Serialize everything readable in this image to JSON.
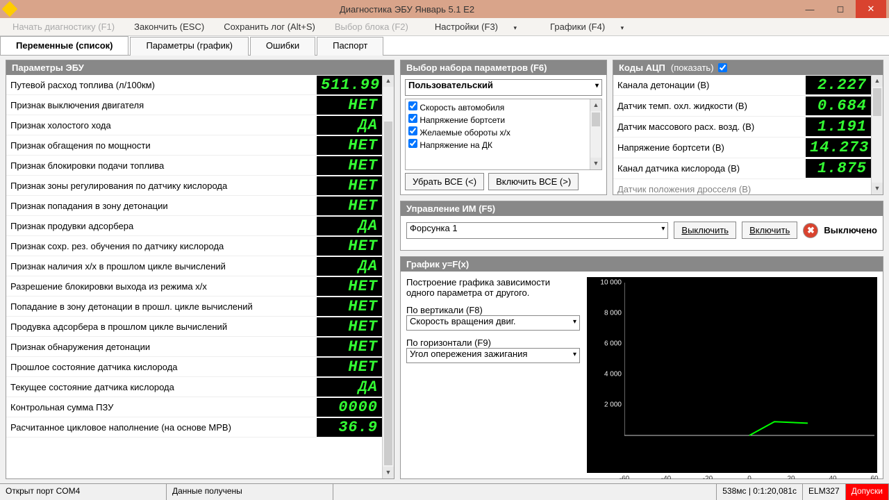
{
  "title": "Диагностика ЭБУ Январь 5.1 Е2",
  "toolbar": {
    "start": "Начать диагностику (F1)",
    "finish": "Закончить (ESC)",
    "savelog": "Сохранить лог (Alt+S)",
    "block": "Выбор блока (F2)",
    "settings": "Настройки (F3)",
    "graphs": "Графики (F4)"
  },
  "tabs": {
    "vars": "Переменные (список)",
    "params": "Параметры (график)",
    "errors": "Ошибки",
    "passport": "Паспорт"
  },
  "ecu_params": {
    "title": "Параметры ЭБУ",
    "rows": [
      {
        "n": "Путевой расход топлива (л/100км)",
        "v": "511.99"
      },
      {
        "n": "Признак выключения двигателя",
        "v": "НЕТ"
      },
      {
        "n": "Признак холостого хода",
        "v": "ДА"
      },
      {
        "n": "Признак обгащения по мощности",
        "v": "НЕТ"
      },
      {
        "n": "Признак блокировки подачи топлива",
        "v": "НЕТ"
      },
      {
        "n": "Признак зоны регулирования по датчику кислорода",
        "v": "НЕТ"
      },
      {
        "n": "Признак попадания в зону детонации",
        "v": "НЕТ"
      },
      {
        "n": "Признак продувки адсорбера",
        "v": "ДА"
      },
      {
        "n": "Признак сохр. рез. обучения по датчику кислорода",
        "v": "НЕТ"
      },
      {
        "n": "Признак наличия х/х в прошлом цикле вычислений",
        "v": "ДА"
      },
      {
        "n": "Разрешение блокировки выхода из режима х/х",
        "v": "НЕТ"
      },
      {
        "n": "Попадание в зону детонации в прошл. цикле вычислений",
        "v": "НЕТ"
      },
      {
        "n": "Продувка адсорбера в прошлом цикле вычислений",
        "v": "НЕТ"
      },
      {
        "n": "Признак обнаружения детонации",
        "v": "НЕТ"
      },
      {
        "n": "Прошлое состояние датчика кислорода",
        "v": "НЕТ"
      },
      {
        "n": "Текущее состояние датчика кислорода",
        "v": "ДА"
      },
      {
        "n": "Контрольная сумма ПЗУ",
        "v": "0000"
      },
      {
        "n": "Расчитанное цикловое наполнение (на основе МРВ)",
        "v": "36.9"
      }
    ]
  },
  "param_set": {
    "title": "Выбор набора параметров (F6)",
    "selected": "Пользовательский",
    "checks": [
      {
        "l": "Скорость автомобиля",
        "c": true
      },
      {
        "l": "Напряжение бортсети",
        "c": true
      },
      {
        "l": "Желаемые обороты х/х",
        "c": true
      },
      {
        "l": "Напряжение на ДК",
        "c": true
      }
    ],
    "remove_all": "Убрать ВСЕ (<)",
    "include_all": "Включить ВСЕ (>)"
  },
  "adc": {
    "title": "Коды АЦП",
    "show_label": "(показать)",
    "show_checked": true,
    "rows": [
      {
        "n": "Канала детонации (В)",
        "v": "2.227"
      },
      {
        "n": "Датчик темп. охл. жидкости (В)",
        "v": "0.684"
      },
      {
        "n": "Датчик массового расх. возд. (В)",
        "v": "1.191"
      },
      {
        "n": "Напряжение бортсети (В)",
        "v": "14.273"
      },
      {
        "n": "Канал датчика кислорода (В)",
        "v": "1.875"
      }
    ],
    "partial": "Датчик положения дросселя (В)"
  },
  "im": {
    "title": "Управление ИМ (F5)",
    "selected": "Форсунка 1",
    "off": "Выключить",
    "on": "Включить",
    "status": "Выключено"
  },
  "graph": {
    "title": "График y=F(x)",
    "desc": "Построение графика зависимости одного параметра от другого.",
    "vlabel": "По вертикали (F8)",
    "vsel": "Скорость вращения двиг.",
    "hlabel": "По горизонтали (F9)",
    "hsel": "Угол опережения зажигания"
  },
  "chart_data": {
    "type": "line",
    "x": [
      -60,
      -40,
      -20,
      0,
      20,
      40,
      60
    ],
    "yticks": [
      2000,
      4000,
      6000,
      8000,
      10000
    ],
    "series": [
      {
        "name": "",
        "points": [
          [
            0,
            0
          ],
          [
            12,
            900
          ],
          [
            28,
            800
          ]
        ]
      }
    ],
    "xlim": [
      -60,
      60
    ],
    "ylim": [
      0,
      10000
    ]
  },
  "status": {
    "port": "Открыт порт COM4",
    "data": "Данные получены",
    "timing": "538мс | 0:1:20,081с",
    "adapter": "ELM327",
    "tolerance": "Допуски"
  }
}
